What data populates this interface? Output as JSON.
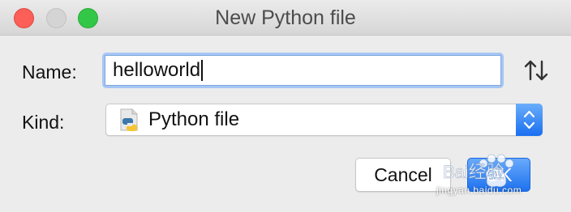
{
  "window": {
    "title": "New Python file"
  },
  "form": {
    "name_label": "Name:",
    "name_value": "helloworld",
    "kind_label": "Kind:",
    "kind_value": "Python file"
  },
  "buttons": {
    "cancel_label": "Cancel",
    "ok_label": "OK"
  },
  "icons": {
    "sort": "sort-arrows-icon",
    "kind": "python-file-icon",
    "stepper": "chevron-updown-icon"
  },
  "colors": {
    "accent": "#1e72f0",
    "close": "#fc5f57",
    "maximize": "#33c748"
  },
  "watermark": {
    "brand": "Bai经验",
    "url": "jingyan.baidu.com"
  }
}
